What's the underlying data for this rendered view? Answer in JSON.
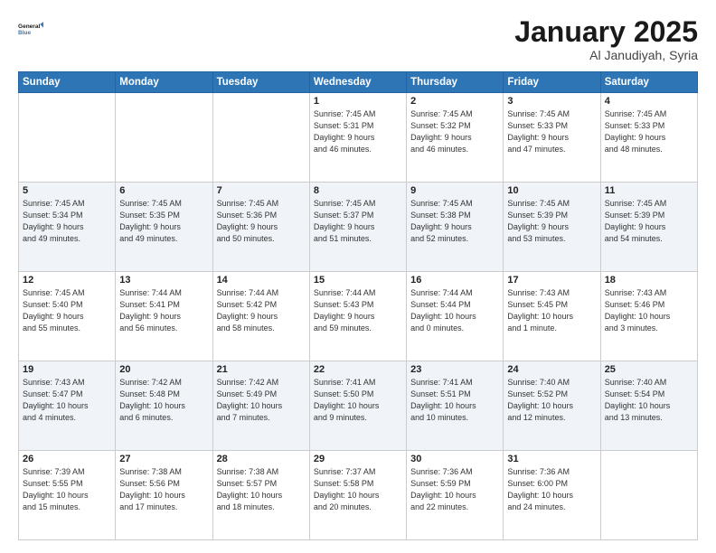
{
  "logo": {
    "line1": "General",
    "line2": "Blue"
  },
  "header": {
    "month": "January 2025",
    "location": "Al Janudiyah, Syria"
  },
  "days_of_week": [
    "Sunday",
    "Monday",
    "Tuesday",
    "Wednesday",
    "Thursday",
    "Friday",
    "Saturday"
  ],
  "weeks": [
    [
      {
        "day": "",
        "info": ""
      },
      {
        "day": "",
        "info": ""
      },
      {
        "day": "",
        "info": ""
      },
      {
        "day": "1",
        "info": "Sunrise: 7:45 AM\nSunset: 5:31 PM\nDaylight: 9 hours\nand 46 minutes."
      },
      {
        "day": "2",
        "info": "Sunrise: 7:45 AM\nSunset: 5:32 PM\nDaylight: 9 hours\nand 46 minutes."
      },
      {
        "day": "3",
        "info": "Sunrise: 7:45 AM\nSunset: 5:33 PM\nDaylight: 9 hours\nand 47 minutes."
      },
      {
        "day": "4",
        "info": "Sunrise: 7:45 AM\nSunset: 5:33 PM\nDaylight: 9 hours\nand 48 minutes."
      }
    ],
    [
      {
        "day": "5",
        "info": "Sunrise: 7:45 AM\nSunset: 5:34 PM\nDaylight: 9 hours\nand 49 minutes."
      },
      {
        "day": "6",
        "info": "Sunrise: 7:45 AM\nSunset: 5:35 PM\nDaylight: 9 hours\nand 49 minutes."
      },
      {
        "day": "7",
        "info": "Sunrise: 7:45 AM\nSunset: 5:36 PM\nDaylight: 9 hours\nand 50 minutes."
      },
      {
        "day": "8",
        "info": "Sunrise: 7:45 AM\nSunset: 5:37 PM\nDaylight: 9 hours\nand 51 minutes."
      },
      {
        "day": "9",
        "info": "Sunrise: 7:45 AM\nSunset: 5:38 PM\nDaylight: 9 hours\nand 52 minutes."
      },
      {
        "day": "10",
        "info": "Sunrise: 7:45 AM\nSunset: 5:39 PM\nDaylight: 9 hours\nand 53 minutes."
      },
      {
        "day": "11",
        "info": "Sunrise: 7:45 AM\nSunset: 5:39 PM\nDaylight: 9 hours\nand 54 minutes."
      }
    ],
    [
      {
        "day": "12",
        "info": "Sunrise: 7:45 AM\nSunset: 5:40 PM\nDaylight: 9 hours\nand 55 minutes."
      },
      {
        "day": "13",
        "info": "Sunrise: 7:44 AM\nSunset: 5:41 PM\nDaylight: 9 hours\nand 56 minutes."
      },
      {
        "day": "14",
        "info": "Sunrise: 7:44 AM\nSunset: 5:42 PM\nDaylight: 9 hours\nand 58 minutes."
      },
      {
        "day": "15",
        "info": "Sunrise: 7:44 AM\nSunset: 5:43 PM\nDaylight: 9 hours\nand 59 minutes."
      },
      {
        "day": "16",
        "info": "Sunrise: 7:44 AM\nSunset: 5:44 PM\nDaylight: 10 hours\nand 0 minutes."
      },
      {
        "day": "17",
        "info": "Sunrise: 7:43 AM\nSunset: 5:45 PM\nDaylight: 10 hours\nand 1 minute."
      },
      {
        "day": "18",
        "info": "Sunrise: 7:43 AM\nSunset: 5:46 PM\nDaylight: 10 hours\nand 3 minutes."
      }
    ],
    [
      {
        "day": "19",
        "info": "Sunrise: 7:43 AM\nSunset: 5:47 PM\nDaylight: 10 hours\nand 4 minutes."
      },
      {
        "day": "20",
        "info": "Sunrise: 7:42 AM\nSunset: 5:48 PM\nDaylight: 10 hours\nand 6 minutes."
      },
      {
        "day": "21",
        "info": "Sunrise: 7:42 AM\nSunset: 5:49 PM\nDaylight: 10 hours\nand 7 minutes."
      },
      {
        "day": "22",
        "info": "Sunrise: 7:41 AM\nSunset: 5:50 PM\nDaylight: 10 hours\nand 9 minutes."
      },
      {
        "day": "23",
        "info": "Sunrise: 7:41 AM\nSunset: 5:51 PM\nDaylight: 10 hours\nand 10 minutes."
      },
      {
        "day": "24",
        "info": "Sunrise: 7:40 AM\nSunset: 5:52 PM\nDaylight: 10 hours\nand 12 minutes."
      },
      {
        "day": "25",
        "info": "Sunrise: 7:40 AM\nSunset: 5:54 PM\nDaylight: 10 hours\nand 13 minutes."
      }
    ],
    [
      {
        "day": "26",
        "info": "Sunrise: 7:39 AM\nSunset: 5:55 PM\nDaylight: 10 hours\nand 15 minutes."
      },
      {
        "day": "27",
        "info": "Sunrise: 7:38 AM\nSunset: 5:56 PM\nDaylight: 10 hours\nand 17 minutes."
      },
      {
        "day": "28",
        "info": "Sunrise: 7:38 AM\nSunset: 5:57 PM\nDaylight: 10 hours\nand 18 minutes."
      },
      {
        "day": "29",
        "info": "Sunrise: 7:37 AM\nSunset: 5:58 PM\nDaylight: 10 hours\nand 20 minutes."
      },
      {
        "day": "30",
        "info": "Sunrise: 7:36 AM\nSunset: 5:59 PM\nDaylight: 10 hours\nand 22 minutes."
      },
      {
        "day": "31",
        "info": "Sunrise: 7:36 AM\nSunset: 6:00 PM\nDaylight: 10 hours\nand 24 minutes."
      },
      {
        "day": "",
        "info": ""
      }
    ]
  ]
}
